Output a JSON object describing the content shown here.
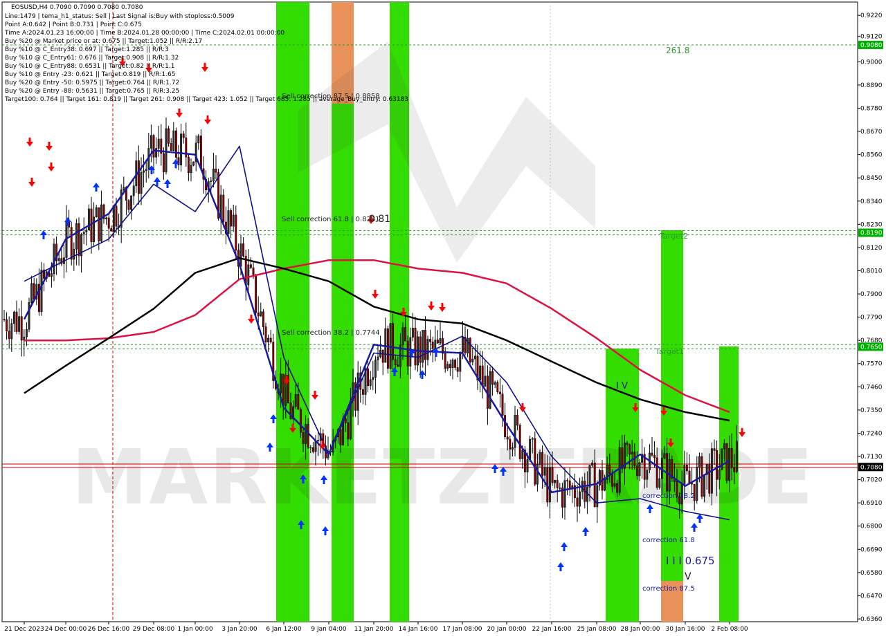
{
  "header": {
    "symbol_line": "EOSUSD,H4  0.7090 0.7090 0.7080 0.7080",
    "lines": [
      "Line:1479 | tema_h1_status: Sell | Last Signal is:Buy with stoploss:0.5009",
      "Point A:0.642 | Point B:0.731 | Point C:0.675",
      "Time A:2024.01.23 16:00:00 | Time B:2024.01.28 00:00:00 | Time C:2024.02.01 00:00:00",
      "Buy %20 @ Market price or at: 0.675 || Target:1.052 || R/R:2.17",
      "Buy %10 @ C_Entry38: 0.697 || Target:1.285 || R/R:3",
      "Buy %10 @ C_Entry61: 0.676 || Target:0.908 || R/R:1.32",
      "Buy %10 @ C_Entry88: 0.6531 || Target:0.82 || R/R:1.1",
      "Buy %10 @ Entry -23: 0.621 || Target:0.819 || R/R:1.65",
      "Buy %20 @ Entry -50: 0.5975 || Target:0.764 || R/R:1.72",
      "Buy %20 @ Entry -88: 0.5631 || Target:0.765 || R/R:3.25",
      "Target100: 0.764 || Target 161: 0.819 || Target 261: 0.908 || Target 423: 1.052 || Target 685: 1.285 || average_Buy_entry: 0.63183"
    ]
  },
  "chart_data": {
    "type": "candlestick",
    "symbol": "EOSUSD",
    "timeframe": "H4",
    "ylim": [
      0.636,
      0.9224
    ],
    "y_ticks": [
      "0.9220",
      "0.9120",
      "0.9000",
      "0.8890",
      "0.8780",
      "0.8670",
      "0.8560",
      "0.8450",
      "0.8340",
      "0.8230",
      "0.8120",
      "0.8010",
      "0.7900",
      "0.7790",
      "0.7680",
      "0.7570",
      "0.7460",
      "0.7350",
      "0.7240",
      "0.7130",
      "0.7020",
      "0.6910",
      "0.6800",
      "0.6690",
      "0.6580",
      "0.6470",
      "0.6360"
    ],
    "x_ticks": [
      "21 Dec 2023",
      "24 Dec 00:00",
      "26 Dec 16:00",
      "29 Dec 08:00",
      "1 Jan 00:00",
      "3 Jan 20:00",
      "6 Jan 12:00",
      "9 Jan 04:00",
      "11 Jan 20:00",
      "14 Jan 16:00",
      "17 Jan 08:00",
      "20 Jan 00:00",
      "22 Jan 16:00",
      "25 Jan 08:00",
      "28 Jan 00:00",
      "30 Jan 16:00",
      "2 Feb 08:00"
    ],
    "price_labels": [
      {
        "value": "0.9080",
        "color": "#00b000"
      },
      {
        "value": "0.8190",
        "color": "#00b000"
      },
      {
        "value": "0.7650",
        "color": "#00b000"
      },
      {
        "value": "0.7080",
        "color": "#000000"
      }
    ],
    "annotations": [
      "261.8",
      "Sell correction 87.5 | 0.8858",
      "Sell correction 61.8 | 0.8281",
      "0.81",
      "Sell correction 38.2 | 0.7744",
      "Target2",
      "Target1",
      "I V",
      "correction 38.2",
      "correction 61.8",
      "correction 87.5",
      "I I I 0.675",
      "V"
    ],
    "watermark": "MARKETZITRADE",
    "colors": {
      "green_zone": "#33dd00",
      "orange_zone": "#e8925a",
      "ma_red": "#dd1144",
      "ma_black": "#000000",
      "ma_navy": "#10108a",
      "ma_blue": "#1a1aa0",
      "buy_arrow": "#0033ff",
      "sell_arrow": "#ff0000",
      "level_green": "#2e9b2e",
      "level_red": "#cc0000"
    },
    "series": [
      {
        "values": [
          0.779,
          0.812,
          0.801,
          0.746,
          0.713,
          0.779,
          0.691,
          0.735,
          0.802,
          0.779,
          0.715,
          0.68,
          0.669,
          0.702,
          0.735,
          0.691,
          0.71
        ]
      },
      {
        "values": [
          0.768,
          0.768,
          0.769,
          0.772,
          0.78,
          0.797,
          0.802,
          0.806,
          0.806,
          0.802,
          0.8,
          0.795,
          0.783,
          0.769,
          0.754,
          0.742,
          0.734
        ]
      },
      {
        "values": [
          0.743,
          0.756,
          0.769,
          0.783,
          0.8,
          0.807,
          0.802,
          0.796,
          0.784,
          0.778,
          0.776,
          0.768,
          0.758,
          0.748,
          0.74,
          0.734,
          0.73
        ]
      },
      {
        "values": [
          0.796,
          0.806,
          0.816,
          0.842,
          0.829,
          0.86,
          0.76,
          0.714,
          0.762,
          0.76,
          0.77,
          0.748,
          0.713,
          0.691,
          0.693,
          0.687,
          0.683
        ]
      },
      {
        "values": [
          0.778,
          0.816,
          0.828,
          0.858,
          0.856,
          0.804,
          0.736,
          0.714,
          0.766,
          0.763,
          0.762,
          0.728,
          0.696,
          0.7,
          0.714,
          0.699,
          0.711
        ]
      }
    ]
  }
}
